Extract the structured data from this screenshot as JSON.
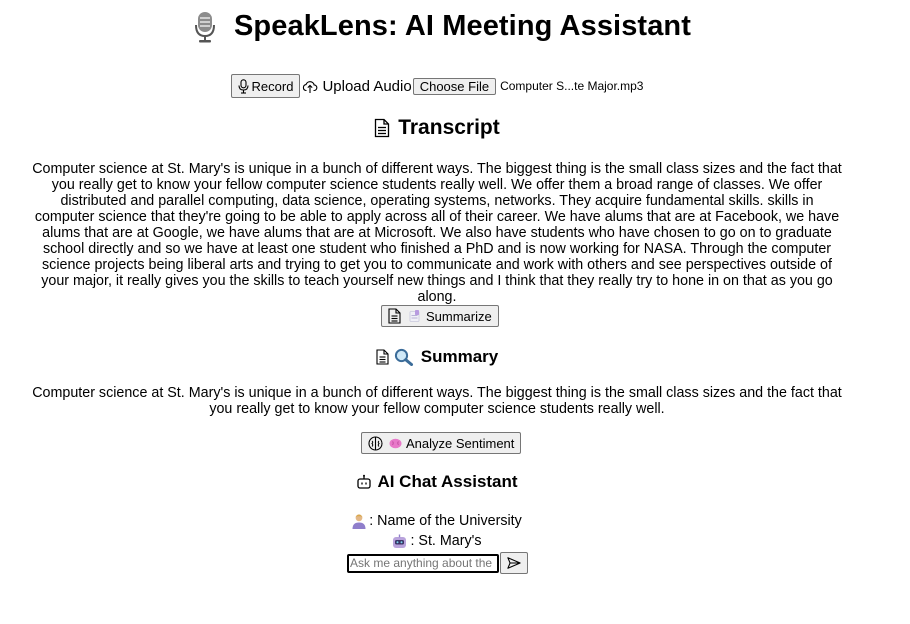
{
  "app": {
    "title": "SpeakLens: AI Meeting Assistant",
    "icon": "microphone-icon"
  },
  "upload": {
    "record_label": "Record",
    "upload_label": "Upload Audio",
    "choose_file_label": "Choose File",
    "file_name": "Computer S...te Major.mp3"
  },
  "transcript": {
    "heading": "Transcript",
    "text": "Computer science at St. Mary's is unique in a bunch of different ways. The biggest thing is the small class sizes and the fact that you really get to know your fellow computer science students really well. We offer them a broad range of classes. We offer distributed and parallel computing, data science, operating systems, networks. They acquire fundamental skills. skills in computer science that they're going to be able to apply across all of their career. We have alums that are at Facebook, we have alums that are at Google, we have alums that are at Microsoft. We also have students who have chosen to go on to graduate school directly and so we have at least one student who finished a PhD and is now working for NASA. Through the computer science projects being liberal arts and trying to get you to communicate and work with others and see perspectives outside of your major, it really gives you the skills to teach yourself new things and I think that they really try to hone in on that as you go along.",
    "summarize_label": "Summarize"
  },
  "summary": {
    "heading": "Summary",
    "text": "Computer science at St. Mary's is unique in a bunch of different ways. The biggest thing is the small class sizes and the fact that you really get to know your fellow computer science students really well.",
    "analyze_label": "Analyze Sentiment"
  },
  "chat": {
    "heading": "AI Chat Assistant",
    "messages": [
      {
        "role_icon": "user-icon",
        "text": ": Name of the University"
      },
      {
        "role_icon": "robot-icon",
        "text": ": St. Mary's"
      }
    ],
    "input_placeholder": "Ask me anything about the",
    "send_icon": "send-icon"
  }
}
